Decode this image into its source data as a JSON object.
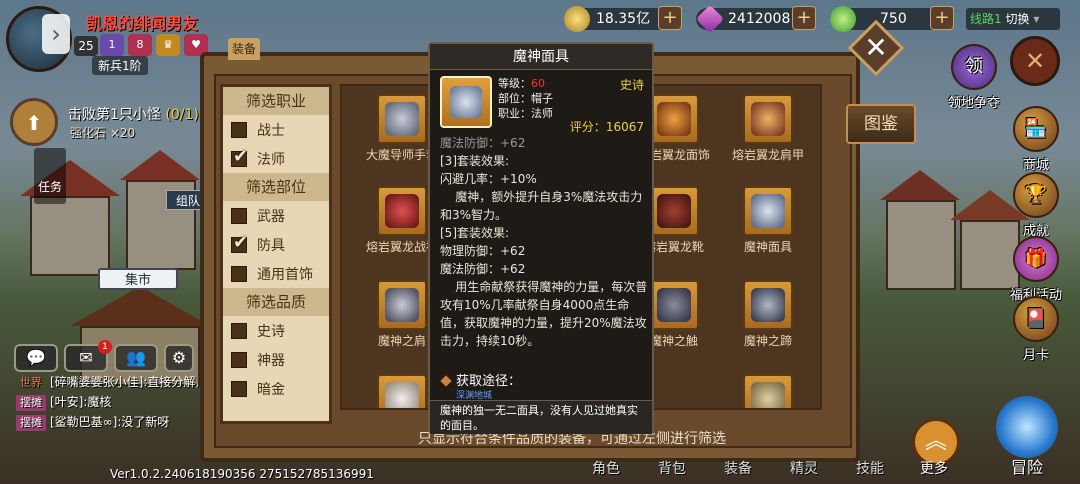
{
  "player": {
    "name": "凯恩的绯闻男友",
    "level": "25",
    "badge1": "1",
    "badge2": "8",
    "newbie": "新兵1阶"
  },
  "resources": {
    "gold": "18.35亿",
    "gems": "2412008",
    "stamina": "750"
  },
  "line_selector": {
    "line": "线路1",
    "switch": "切换"
  },
  "quest": {
    "title": "击败第1只小怪",
    "count": "(0/1)",
    "reward": "强化石 ×20"
  },
  "left_buttons": {
    "task": "任务",
    "team": "组队",
    "market": "集市"
  },
  "chat": {
    "badge_count": "1",
    "rows": [
      {
        "tag": "世界",
        "text": "[碎嘴婆婆张小佳]:直接分解,"
      },
      {
        "tag": "摆摊",
        "text": "[叶安]:魔核"
      },
      {
        "tag": "摆摊",
        "text": "[鲨勒巴基∞]:没了新呀"
      }
    ]
  },
  "version": "Ver1.0.2.240618190356 275152785136991",
  "right_menu": {
    "territory": "领地争夺",
    "shop": "商城",
    "achievement": "成就",
    "welfare": "福利活动",
    "monthly": "月卡",
    "atlas": "图鉴"
  },
  "bottom_nav": {
    "items": [
      "角色",
      "背包",
      "装备",
      "精灵",
      "技能"
    ],
    "more": "更多",
    "adventure": "冒险"
  },
  "panel": {
    "tab": "装备",
    "hint": "只显示符合条件品质的装备，可通过左侧进行筛选"
  },
  "filters": {
    "class_header": "筛选职业",
    "class_items": [
      {
        "label": "战士",
        "checked": false
      },
      {
        "label": "法师",
        "checked": true
      }
    ],
    "part_header": "筛选部位",
    "part_items": [
      {
        "label": "武器",
        "checked": false
      },
      {
        "label": "防具",
        "checked": true
      },
      {
        "label": "通用首饰",
        "checked": false
      }
    ],
    "quality_header": "筛选品质",
    "quality_items": [
      {
        "label": "史诗",
        "checked": false
      },
      {
        "label": "神器",
        "checked": false
      },
      {
        "label": "暗金",
        "checked": false
      }
    ]
  },
  "grid": {
    "items": [
      "大魔导师手套",
      "",
      "",
      "熔岩翼龙面饰",
      "熔岩翼龙肩甲",
      "熔岩翼龙战袍",
      "",
      "",
      "熔岩翼龙靴",
      "魔神面具",
      "魔神之肩",
      "",
      "",
      "魔神之触",
      "魔神之蹄",
      "",
      "",
      "",
      "",
      ""
    ]
  },
  "tooltip": {
    "title": "魔神面具",
    "quality": "史诗",
    "level_label": "等级：",
    "level": "60",
    "part": "部位：帽子",
    "class": "职业：法师",
    "score_label": "评分：",
    "score": "16067",
    "body": [
      "魔法防御：+62",
      "[3]套装效果:",
      "闪避几率：+10%",
      "    魔神，额外提升自身3%魔法攻击力和3%智力。",
      "[5]套装效果:",
      "物理防御：+62",
      "魔法防御：+62",
      "    用生命献祭获得魔神的力量，每次普攻有10%几率献祭自身4000点生命值，获取魔神的力量，提升20%魔法攻击力，持续10秒。"
    ],
    "acquire": "获取途径：",
    "acquire_sub": "深渊地城",
    "description": "魔神的独一无二面具，没有人见过她真实的面目。"
  },
  "colors": {
    "panel": "#7a5a34",
    "tooltip_bg": "#1e1a16",
    "gold_text": "#f0d040",
    "red_text": "#ff3030"
  }
}
